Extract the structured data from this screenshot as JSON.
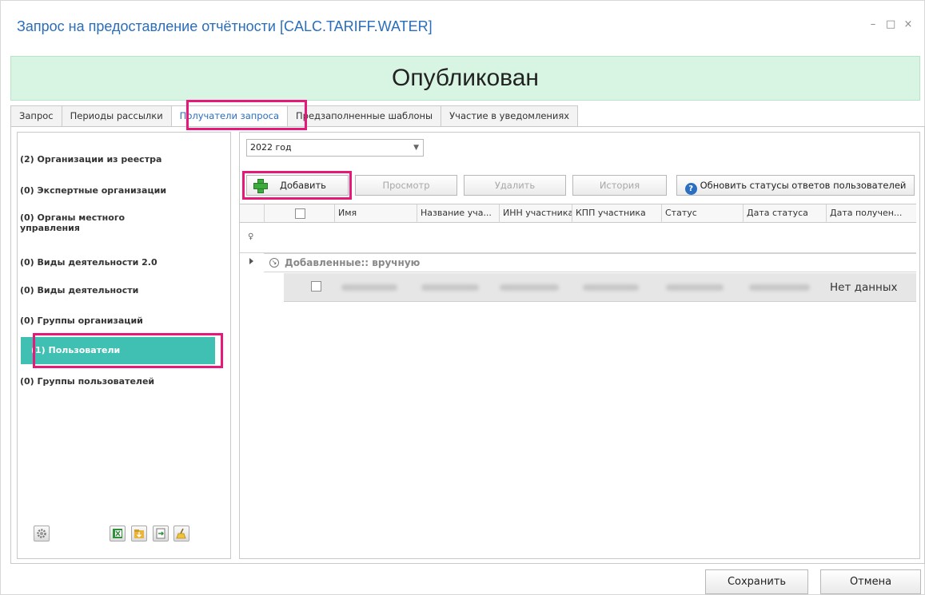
{
  "window": {
    "title": "Запрос на предоставление отчётности [CALC.TARIFF.WATER]",
    "controls": {
      "minimize": "–",
      "maximize": "□",
      "close": "×"
    }
  },
  "status": {
    "label": "Опубликован",
    "color": "#d8f5e3"
  },
  "tabs": [
    {
      "label": "Запрос"
    },
    {
      "label": "Периоды рассылки"
    },
    {
      "label": "Получатели запроса",
      "active": true
    },
    {
      "label": "Предзаполненные шаблоны"
    },
    {
      "label": "Участие в уведомлениях"
    }
  ],
  "sidebar": {
    "items": [
      {
        "label": "(2) Организации из реестра"
      },
      {
        "label": "(0) Экспертные организации"
      },
      {
        "label": "(0) Органы местного управления"
      },
      {
        "label": "(0) Виды деятельности 2.0"
      },
      {
        "label": "(0) Виды деятельности"
      },
      {
        "label": "(0) Группы организаций"
      },
      {
        "label": "(1) Пользователи",
        "active": true
      },
      {
        "label": "(0) Группы пользователей"
      }
    ],
    "active_color": "#40bfb3",
    "bottom_icons": [
      "settings-icon",
      "excel-export-icon",
      "folder-import-icon",
      "file-export-icon",
      "clear-broom-icon"
    ]
  },
  "filter": {
    "year_value": "2022 год"
  },
  "toolbar": {
    "add": "Добавить",
    "view": "Просмотр",
    "delete": "Удалить",
    "history": "История",
    "refresh": "Обновить статусы ответов пользователей"
  },
  "grid": {
    "columns": [
      "Имя",
      "Название уча...",
      "ИНН участника",
      "КПП участника",
      "Статус",
      "Дата статуса",
      "Дата получен..."
    ],
    "group_label": "Добавленные:: вручную",
    "rows": [
      {
        "status_received": "Нет данных"
      }
    ]
  },
  "footer": {
    "save": "Сохранить",
    "cancel": "Отмена"
  },
  "highlight_color": "#e6197a"
}
